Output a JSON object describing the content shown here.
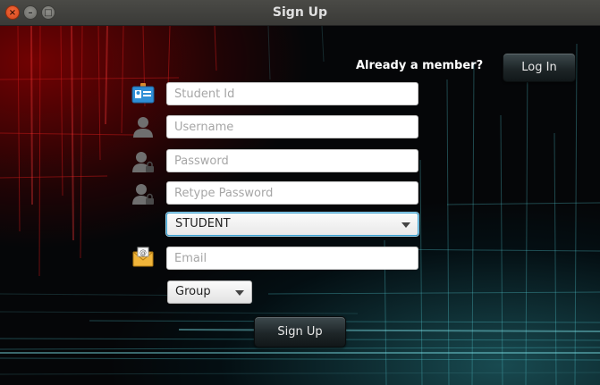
{
  "window": {
    "title": "Sign Up"
  },
  "header": {
    "already_member": "Already a member?",
    "login_label": "Log In"
  },
  "form": {
    "student_id": {
      "value": "",
      "placeholder": "Student Id",
      "icon": "id-card-icon"
    },
    "username": {
      "value": "",
      "placeholder": "Username",
      "icon": "user-icon"
    },
    "password": {
      "value": "",
      "placeholder": "Password",
      "icon": "user-lock-icon"
    },
    "retype_password": {
      "value": "",
      "placeholder": "Retype Password",
      "icon": "user-lock-icon"
    },
    "role": {
      "selected": "STUDENT"
    },
    "email": {
      "value": "",
      "placeholder": "Email",
      "icon": "email-icon"
    },
    "group": {
      "selected": "Group"
    },
    "signup_label": "Sign Up"
  },
  "colors": {
    "accent": "#3aa0d0",
    "close_button": "#e5531f",
    "background_red": "#960000",
    "background_teal": "#2a8c96"
  }
}
